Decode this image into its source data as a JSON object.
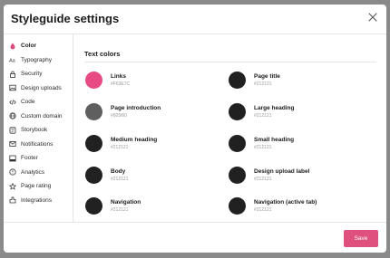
{
  "modal": {
    "title": "Styleguide settings",
    "close_icon": "close-icon"
  },
  "sidebar": {
    "items": [
      {
        "label": "Color",
        "icon": "color-icon",
        "active": true
      },
      {
        "label": "Typography",
        "icon": "typography-icon"
      },
      {
        "label": "Security",
        "icon": "lock-icon"
      },
      {
        "label": "Design uploads",
        "icon": "image-icon"
      },
      {
        "label": "Code",
        "icon": "code-icon"
      },
      {
        "label": "Custom domain",
        "icon": "globe-icon"
      },
      {
        "label": "Storybook",
        "icon": "storybook-icon"
      },
      {
        "label": "Notifications",
        "icon": "notifications-icon"
      },
      {
        "label": "Footer",
        "icon": "footer-icon"
      },
      {
        "label": "Analytics",
        "icon": "analytics-icon"
      },
      {
        "label": "Page rating",
        "icon": "star-icon"
      },
      {
        "label": "Integrations",
        "icon": "integrations-icon"
      }
    ]
  },
  "main": {
    "section_title": "Text colors",
    "colors": [
      {
        "name": "Links",
        "hex": "#F63E7C",
        "swatch": "#e84a83"
      },
      {
        "name": "Page title",
        "hex": "#212121",
        "swatch": "#212121"
      },
      {
        "name": "Page introduction",
        "hex": "#605f60",
        "swatch": "#605f60"
      },
      {
        "name": "Large heading",
        "hex": "#212121",
        "swatch": "#212121"
      },
      {
        "name": "Medium heading",
        "hex": "#212121",
        "swatch": "#212121"
      },
      {
        "name": "Small heading",
        "hex": "#212121",
        "swatch": "#212121"
      },
      {
        "name": "Body",
        "hex": "#212121",
        "swatch": "#212121"
      },
      {
        "name": "Design upload label",
        "hex": "#212121",
        "swatch": "#212121"
      },
      {
        "name": "Navigation",
        "hex": "#212121",
        "swatch": "#212121"
      },
      {
        "name": "Navigation (active tab)",
        "hex": "#212121",
        "swatch": "#212121"
      }
    ]
  },
  "footer": {
    "save_label": "Save",
    "accent_color": "#e0507e"
  },
  "colors": {
    "accent": "#e0507e",
    "backdrop": "#8a8a8a"
  }
}
